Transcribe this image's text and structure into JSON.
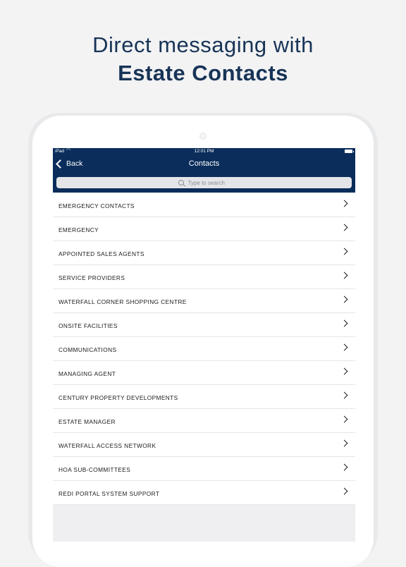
{
  "promo": {
    "headline_line1": "Direct messaging with",
    "headline_line2": "Estate Contacts"
  },
  "status_bar": {
    "carrier": "iPad",
    "time": "12:01 PM"
  },
  "navbar": {
    "back_label": "Back",
    "title": "Contacts",
    "search_placeholder": "Type to search"
  },
  "contacts": [
    {
      "label": "EMERGENCY CONTACTS"
    },
    {
      "label": "EMERGENCY"
    },
    {
      "label": "APPOINTED SALES AGENTS"
    },
    {
      "label": "SERVICE PROVIDERS"
    },
    {
      "label": "WATERFALL CORNER SHOPPING CENTRE"
    },
    {
      "label": "ONSITE FACILITIES"
    },
    {
      "label": "COMMUNICATIONS"
    },
    {
      "label": "MANAGING AGENT"
    },
    {
      "label": "CENTURY PROPERTY DEVELOPMENTS"
    },
    {
      "label": "ESTATE MANAGER"
    },
    {
      "label": "WATERFALL ACCESS NETWORK"
    },
    {
      "label": "HOA SUB-COMMITTEES"
    },
    {
      "label": "REDI PORTAL SYSTEM SUPPORT"
    }
  ],
  "colors": {
    "navbar": "#0a2d5b",
    "headline": "#173456",
    "page_background": "#f3f3f4"
  }
}
